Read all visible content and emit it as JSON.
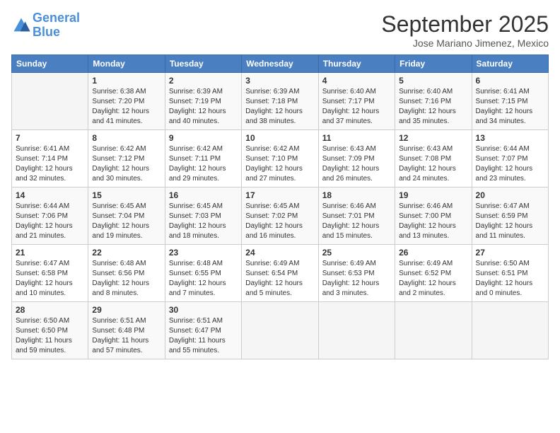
{
  "header": {
    "logo_line1": "General",
    "logo_line2": "Blue",
    "month_title": "September 2025",
    "location": "Jose Mariano Jimenez, Mexico"
  },
  "days_of_week": [
    "Sunday",
    "Monday",
    "Tuesday",
    "Wednesday",
    "Thursday",
    "Friday",
    "Saturday"
  ],
  "weeks": [
    [
      {
        "day": "",
        "info": ""
      },
      {
        "day": "1",
        "info": "Sunrise: 6:38 AM\nSunset: 7:20 PM\nDaylight: 12 hours\nand 41 minutes."
      },
      {
        "day": "2",
        "info": "Sunrise: 6:39 AM\nSunset: 7:19 PM\nDaylight: 12 hours\nand 40 minutes."
      },
      {
        "day": "3",
        "info": "Sunrise: 6:39 AM\nSunset: 7:18 PM\nDaylight: 12 hours\nand 38 minutes."
      },
      {
        "day": "4",
        "info": "Sunrise: 6:40 AM\nSunset: 7:17 PM\nDaylight: 12 hours\nand 37 minutes."
      },
      {
        "day": "5",
        "info": "Sunrise: 6:40 AM\nSunset: 7:16 PM\nDaylight: 12 hours\nand 35 minutes."
      },
      {
        "day": "6",
        "info": "Sunrise: 6:41 AM\nSunset: 7:15 PM\nDaylight: 12 hours\nand 34 minutes."
      }
    ],
    [
      {
        "day": "7",
        "info": "Sunrise: 6:41 AM\nSunset: 7:14 PM\nDaylight: 12 hours\nand 32 minutes."
      },
      {
        "day": "8",
        "info": "Sunrise: 6:42 AM\nSunset: 7:12 PM\nDaylight: 12 hours\nand 30 minutes."
      },
      {
        "day": "9",
        "info": "Sunrise: 6:42 AM\nSunset: 7:11 PM\nDaylight: 12 hours\nand 29 minutes."
      },
      {
        "day": "10",
        "info": "Sunrise: 6:42 AM\nSunset: 7:10 PM\nDaylight: 12 hours\nand 27 minutes."
      },
      {
        "day": "11",
        "info": "Sunrise: 6:43 AM\nSunset: 7:09 PM\nDaylight: 12 hours\nand 26 minutes."
      },
      {
        "day": "12",
        "info": "Sunrise: 6:43 AM\nSunset: 7:08 PM\nDaylight: 12 hours\nand 24 minutes."
      },
      {
        "day": "13",
        "info": "Sunrise: 6:44 AM\nSunset: 7:07 PM\nDaylight: 12 hours\nand 23 minutes."
      }
    ],
    [
      {
        "day": "14",
        "info": "Sunrise: 6:44 AM\nSunset: 7:06 PM\nDaylight: 12 hours\nand 21 minutes."
      },
      {
        "day": "15",
        "info": "Sunrise: 6:45 AM\nSunset: 7:04 PM\nDaylight: 12 hours\nand 19 minutes."
      },
      {
        "day": "16",
        "info": "Sunrise: 6:45 AM\nSunset: 7:03 PM\nDaylight: 12 hours\nand 18 minutes."
      },
      {
        "day": "17",
        "info": "Sunrise: 6:45 AM\nSunset: 7:02 PM\nDaylight: 12 hours\nand 16 minutes."
      },
      {
        "day": "18",
        "info": "Sunrise: 6:46 AM\nSunset: 7:01 PM\nDaylight: 12 hours\nand 15 minutes."
      },
      {
        "day": "19",
        "info": "Sunrise: 6:46 AM\nSunset: 7:00 PM\nDaylight: 12 hours\nand 13 minutes."
      },
      {
        "day": "20",
        "info": "Sunrise: 6:47 AM\nSunset: 6:59 PM\nDaylight: 12 hours\nand 11 minutes."
      }
    ],
    [
      {
        "day": "21",
        "info": "Sunrise: 6:47 AM\nSunset: 6:58 PM\nDaylight: 12 hours\nand 10 minutes."
      },
      {
        "day": "22",
        "info": "Sunrise: 6:48 AM\nSunset: 6:56 PM\nDaylight: 12 hours\nand 8 minutes."
      },
      {
        "day": "23",
        "info": "Sunrise: 6:48 AM\nSunset: 6:55 PM\nDaylight: 12 hours\nand 7 minutes."
      },
      {
        "day": "24",
        "info": "Sunrise: 6:49 AM\nSunset: 6:54 PM\nDaylight: 12 hours\nand 5 minutes."
      },
      {
        "day": "25",
        "info": "Sunrise: 6:49 AM\nSunset: 6:53 PM\nDaylight: 12 hours\nand 3 minutes."
      },
      {
        "day": "26",
        "info": "Sunrise: 6:49 AM\nSunset: 6:52 PM\nDaylight: 12 hours\nand 2 minutes."
      },
      {
        "day": "27",
        "info": "Sunrise: 6:50 AM\nSunset: 6:51 PM\nDaylight: 12 hours\nand 0 minutes."
      }
    ],
    [
      {
        "day": "28",
        "info": "Sunrise: 6:50 AM\nSunset: 6:50 PM\nDaylight: 11 hours\nand 59 minutes."
      },
      {
        "day": "29",
        "info": "Sunrise: 6:51 AM\nSunset: 6:48 PM\nDaylight: 11 hours\nand 57 minutes."
      },
      {
        "day": "30",
        "info": "Sunrise: 6:51 AM\nSunset: 6:47 PM\nDaylight: 11 hours\nand 55 minutes."
      },
      {
        "day": "",
        "info": ""
      },
      {
        "day": "",
        "info": ""
      },
      {
        "day": "",
        "info": ""
      },
      {
        "day": "",
        "info": ""
      }
    ]
  ]
}
